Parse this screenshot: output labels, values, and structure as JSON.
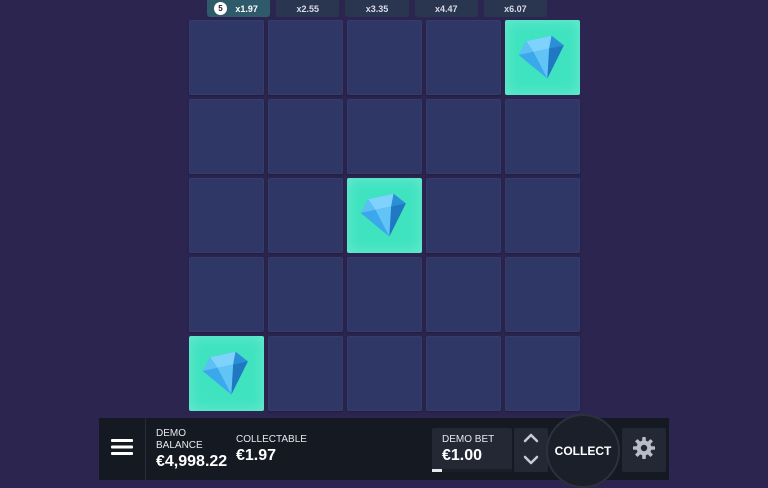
{
  "multipliers": {
    "current_step": "5",
    "items": [
      {
        "label": "x1.97"
      },
      {
        "label": "x2.55"
      },
      {
        "label": "x3.35"
      },
      {
        "label": "x4.47"
      },
      {
        "label": "x6.07"
      }
    ]
  },
  "board": {
    "rows": 5,
    "cols": 5,
    "revealed": [
      [
        0,
        4
      ],
      [
        2,
        2
      ],
      [
        4,
        0
      ]
    ],
    "gem_icon": "diamond-icon",
    "colors": {
      "tile": "#2f3767",
      "revealed_tile": "#3fe3c0",
      "gem": "#3aa8ea"
    }
  },
  "panel": {
    "balance_label": "DEMO BALANCE",
    "balance_value": "€4,998.22",
    "collectable_label": "COLLECTABLE",
    "collectable_value": "€1.97",
    "bet_label": "DEMO BET",
    "bet_value": "€1.00",
    "bet_level_fraction": 0.12,
    "collect_label": "COLLECT",
    "menu_icon": "hamburger-menu-icon",
    "settings_icon": "gear-icon"
  }
}
